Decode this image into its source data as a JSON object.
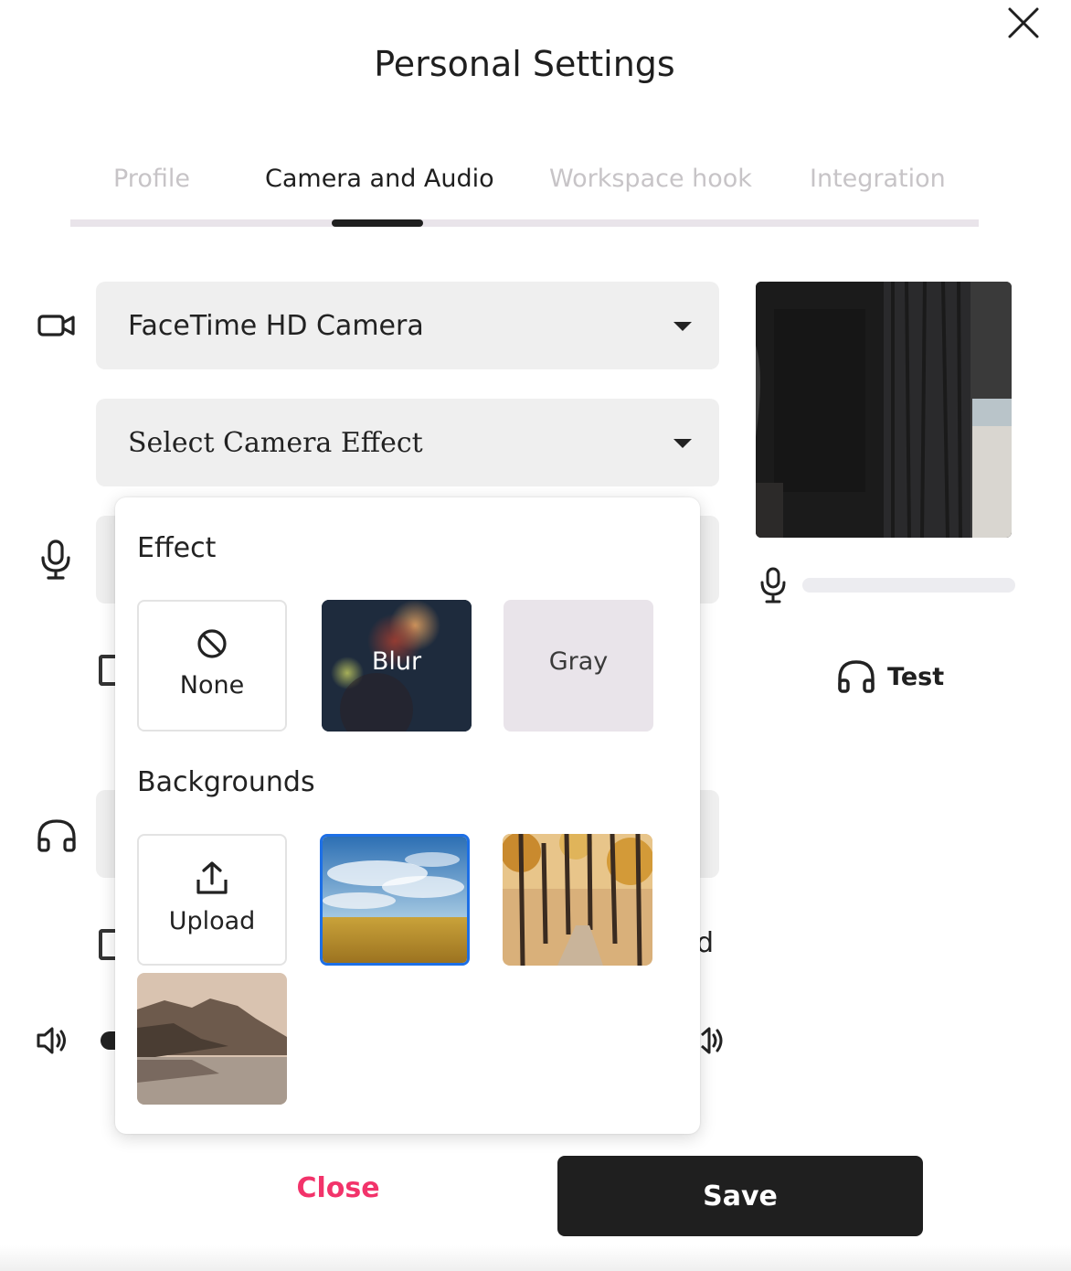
{
  "dialog": {
    "title": "Personal Settings",
    "close_icon": "close-icon"
  },
  "tabs": [
    {
      "label": "Profile",
      "active": false
    },
    {
      "label": "Camera and Audio",
      "active": true
    },
    {
      "label": "Workspace hook",
      "active": false
    },
    {
      "label": "Integration",
      "active": false
    }
  ],
  "camera": {
    "device": "FaceTime HD Camera",
    "effect_placeholder": "Select Camera Effect"
  },
  "test": {
    "label": "Test"
  },
  "effect_popup": {
    "effect_heading": "Effect",
    "effects": [
      {
        "label": "None",
        "icon": "ban-icon"
      },
      {
        "label": "Blur"
      },
      {
        "label": "Gray"
      }
    ],
    "backgrounds_heading": "Backgrounds",
    "upload_label": "Upload",
    "backgrounds": [
      "sky-field",
      "autumn-forest",
      "mountain-lake"
    ],
    "selected_background": "sky-field"
  },
  "partial_text": {
    "d": "d"
  },
  "footer": {
    "close_label": "Close",
    "save_label": "Save"
  },
  "colors": {
    "accent": "#f2336a",
    "selection": "#1d6fe6",
    "primary_button": "#1f1f1f"
  }
}
